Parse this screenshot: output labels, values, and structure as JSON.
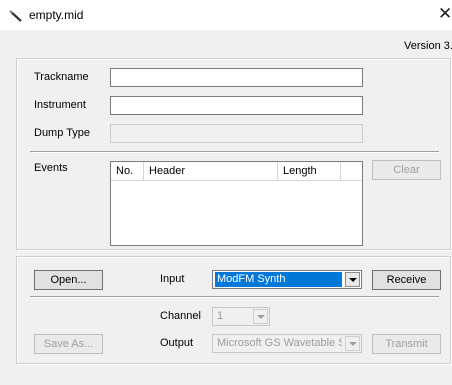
{
  "window": {
    "title": "empty.mid",
    "version": "Version 3."
  },
  "track": {
    "trackname_label": "Trackname",
    "trackname_value": "",
    "instrument_label": "Instrument",
    "instrument_value": "",
    "dump_type_label": "Dump Type",
    "dump_type_value": ""
  },
  "events": {
    "label": "Events",
    "columns": [
      "No.",
      "Header",
      "Length"
    ],
    "rows": [],
    "clear_label": "Clear"
  },
  "midi": {
    "open_label": "Open...",
    "input_label": "Input",
    "input_value": "ModFM Synth",
    "receive_label": "Receive",
    "channel_label": "Channel",
    "channel_value": "1",
    "save_as_label": "Save As...",
    "output_label": "Output",
    "output_value": "Microsoft GS Wavetable Synt",
    "transmit_label": "Transmit"
  },
  "colors": {
    "selection": "#0078d7",
    "window_bg": "#f0f0f0"
  }
}
